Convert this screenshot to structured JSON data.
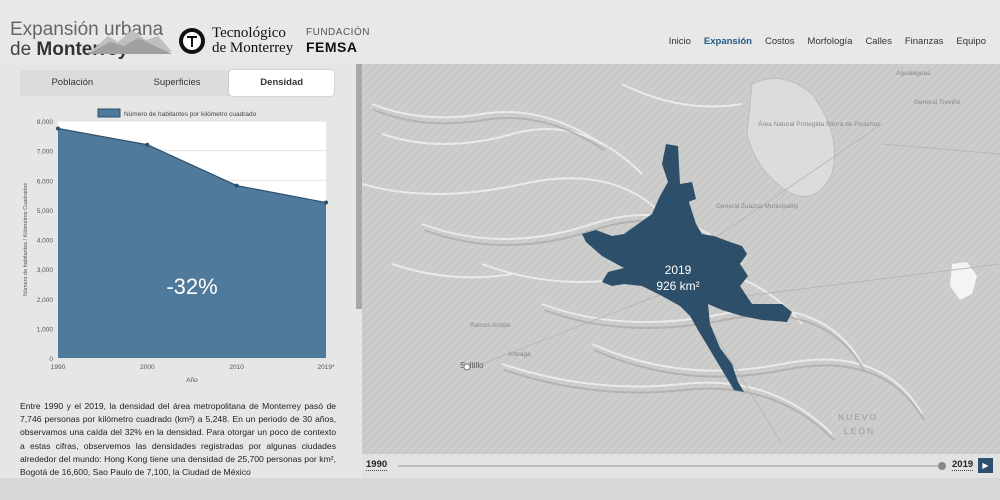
{
  "header": {
    "logo_line1": "Expansión urbana",
    "logo_line2_prefix": "de ",
    "logo_line2_bold": "Monterrey",
    "tec_line1": "Tecnológico",
    "tec_line2": "de Monterrey",
    "femsa_small": "FUNDACIÓN",
    "femsa_big": "FEMSA"
  },
  "nav": {
    "items": [
      "Inicio",
      "Expansión",
      "Costos",
      "Morfología",
      "Calles",
      "Finanzas",
      "Equipo"
    ],
    "active": "Expansión"
  },
  "tabs": {
    "items": [
      "Población",
      "Superficies",
      "Densidad"
    ],
    "active": "Densidad"
  },
  "chart_data": {
    "type": "area",
    "legend": "Número de habitantes por kilómetro cuadrado",
    "x": [
      "1990",
      "2000",
      "2010",
      "2019*"
    ],
    "values": [
      7746,
      7200,
      5820,
      5248
    ],
    "ylim": [
      0,
      8000
    ],
    "yticks": [
      "0",
      "1,000",
      "2,000",
      "3,000",
      "4,000",
      "5,000",
      "6,000",
      "7,000",
      "8,000"
    ],
    "xlabel": "Año",
    "ylabel": "Número de habitantes / Kilómetros Cuadrados",
    "annotation": "-32%",
    "fill_color": "#4f7a9c",
    "line_color": "#2c4f6e",
    "grid": true
  },
  "description": "Entre 1990 y el 2019, la densidad del área metropolitana de Monterrey pasó de 7,746 personas por kilómetro cuadrado (km²) a 5,248. En un periodo de 30 años, observamos una caída del 32% en la densidad. Para otorgar un poco de contexto a estas cifras, observemos las densidades registradas por algunas ciudades alrededor del mundo: Hong Kong tiene una densidad de 25,700 personas por km², Bogotá de 16,600, Sao Paulo de 7,100, la Ciudad de México",
  "map": {
    "year_label": "2019",
    "area_label": "926 km²",
    "place_labels": [
      "Agualeguas",
      "General Treviño",
      "Área Natural Protegida Sierra de Picachos",
      "General Zuazua Municipality",
      "Ramos Arizpe",
      "Arteaga",
      "Saltillo",
      "NUEVO",
      "LEÓN"
    ],
    "urban_color": "#2e4f6a"
  },
  "timeline": {
    "start": "1990",
    "end": "2019",
    "position": 1.0
  },
  "colors": {
    "accent": "#1f5a8a",
    "map_base": "#cfcfcd"
  }
}
